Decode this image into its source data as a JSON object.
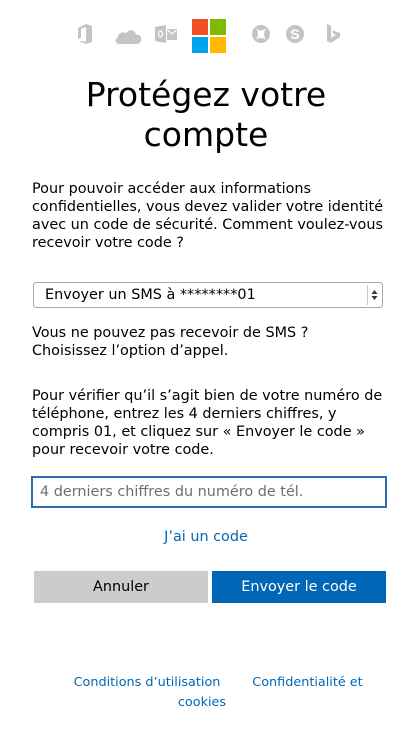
{
  "header": {
    "icons": [
      "office-icon",
      "onedrive-icon",
      "outlook-icon",
      "microsoft-logo",
      "xbox-icon",
      "skype-icon",
      "bing-icon"
    ]
  },
  "title": {
    "line1": "Protégez votre",
    "line2": "compte"
  },
  "intro": {
    "line1": "Pour pouvoir accéder aux informations",
    "line2": "confidentielles, vous devez valider votre identité",
    "line3": "avec un code de sécurité. Comment voulez-vous",
    "line4": "recevoir votre code ?"
  },
  "method_select": {
    "selected": "Envoyer un SMS à ********01"
  },
  "sms_help": {
    "line1": "Vous ne pouvez pas recevoir de SMS ?",
    "line2": "Choisissez l’option d’appel."
  },
  "verify_text": {
    "line1": "Pour vérifier qu’il s’agit bien de votre numéro de",
    "line2": "téléphone, entrez les 4 derniers chiffres, y",
    "line3": "compris 01, et cliquez sur « Envoyer le code »",
    "line4": "pour recevoir votre code."
  },
  "phone_input": {
    "value": "",
    "placeholder": "4 derniers chiffres du numéro de tél."
  },
  "have_code_link": "J’ai un code",
  "buttons": {
    "cancel": "Annuler",
    "send": "Envoyer le code"
  },
  "footer": {
    "terms_line1": "Conditions d’utilisation",
    "terms_line2": "cookies",
    "privacy_line1": "Confidentialité et"
  },
  "colors": {
    "accent": "#0067b8",
    "input_border": "#2b6cb5",
    "cancel_bg": "#cccccc",
    "icon_gray": "#c4c4c4"
  }
}
